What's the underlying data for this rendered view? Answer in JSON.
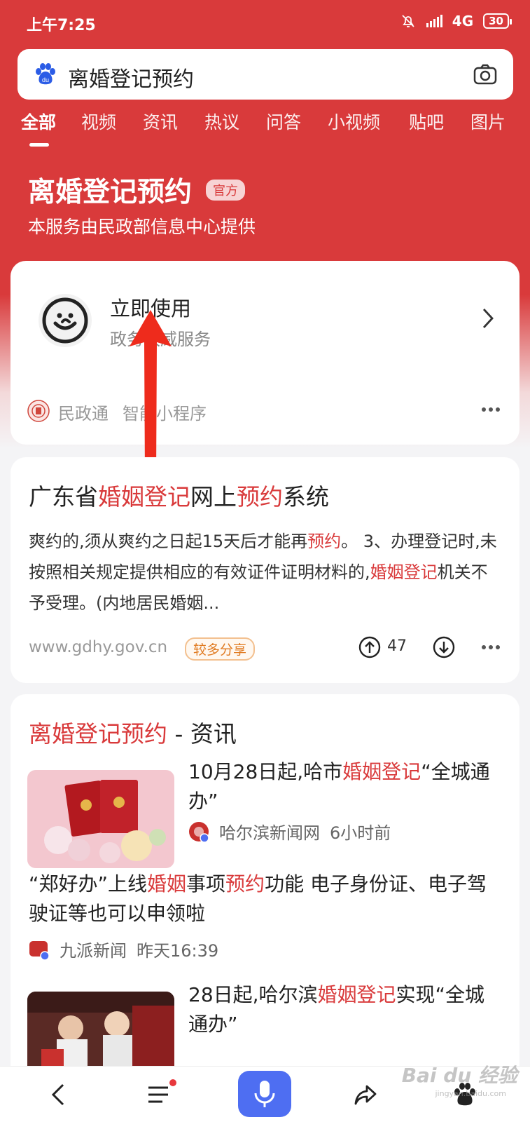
{
  "status_bar": {
    "time": "上午7:25",
    "network": "4G",
    "battery": "30"
  },
  "search": {
    "query": "离婚登记预约"
  },
  "tabs": [
    "全部",
    "视频",
    "资讯",
    "热议",
    "问答",
    "小视频",
    "贴吧",
    "图片"
  ],
  "hero": {
    "title": "离婚登记预约",
    "badge": "官方",
    "subtitle": "本服务由民政部信息中心提供"
  },
  "service": {
    "title": "立即使用",
    "desc": "政务权威服务",
    "provider": "民政通",
    "type": "智能小程序"
  },
  "result": {
    "title_parts": [
      "广东省",
      "婚姻登记",
      "网上",
      "预约",
      "系统"
    ],
    "snippet_parts": [
      "爽约的,须从爽约之日起15天后才能再",
      "预约",
      "。 3、办理登记时,未按照相关规定提供相应的有效证件证明材料的,",
      "婚姻登记",
      "机关不予受理。(内地居民婚姻..."
    ],
    "url": "www.gdhy.gov.cn",
    "badge": "较多分享",
    "up_count": "47"
  },
  "news": {
    "header_highlight": "离婚登记预约",
    "header_rest": " - 资讯",
    "items": [
      {
        "title_parts": [
          "10月28日起,哈市",
          "婚姻登记",
          "“全城通办”"
        ],
        "source": "哈尔滨新闻网",
        "time": "6小时前"
      },
      {
        "title_parts": [
          "“郑好办”上线",
          "婚姻",
          "事项",
          "预约",
          "功能 电子身份证、电子驾驶证等也可以申领啦"
        ],
        "source": "九派新闻",
        "time": "昨天16:39"
      },
      {
        "title_parts": [
          "28日起,哈尔滨",
          "婚姻登记",
          "实现“全城通办”"
        ]
      }
    ]
  },
  "watermark": {
    "brand": "Bai du 经验",
    "url": "jingyan.baidu.com"
  },
  "colors": {
    "brand_red": "#d93a3b",
    "mic_blue": "#4e6ef2",
    "badge_orange": "#e07a20"
  }
}
